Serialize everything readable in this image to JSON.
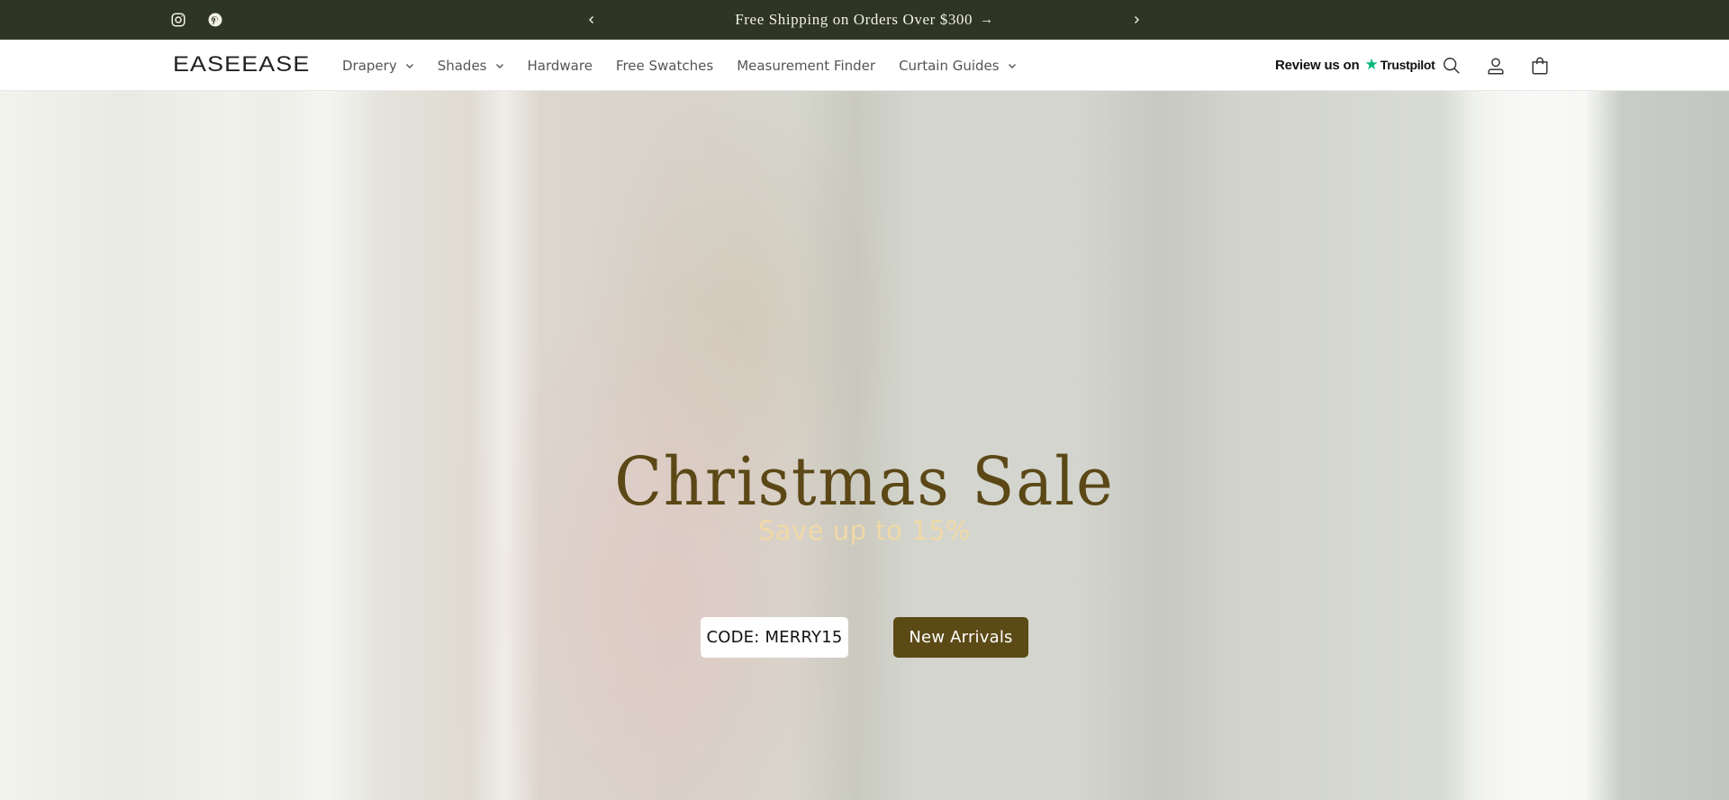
{
  "colors": {
    "announce_bg": "#2e3524",
    "announce_text": "#f4f1e6",
    "hero_title": "#5b4816",
    "hero_subtitle": "#f0d9a6",
    "primary_button": "#5b4a16",
    "trustpilot_green": "#00b67a"
  },
  "announcement": {
    "social_icons": [
      "instagram-icon",
      "pinterest-icon"
    ],
    "text": "Free Shipping on Orders Over $300",
    "prev_icon": "chevron-left-icon",
    "next_icon": "chevron-right-icon"
  },
  "header": {
    "logo": "EASEEASE",
    "nav": [
      {
        "label": "Drapery",
        "has_dropdown": true
      },
      {
        "label": "Shades",
        "has_dropdown": true
      },
      {
        "label": "Hardware",
        "has_dropdown": false
      },
      {
        "label": "Free Swatches",
        "has_dropdown": false
      },
      {
        "label": "Measurement Finder",
        "has_dropdown": false
      },
      {
        "label": "Curtain Guides",
        "has_dropdown": true
      }
    ],
    "trustpilot": {
      "review_text": "Review us on",
      "brand": "Trustpilot"
    },
    "icons": [
      "search-icon",
      "account-icon",
      "cart-icon"
    ]
  },
  "hero": {
    "title": "Christmas Sale",
    "subtitle": "Save up to 15%",
    "code_button": "CODE: MERRY15",
    "cta_button": "New Arrivals"
  }
}
